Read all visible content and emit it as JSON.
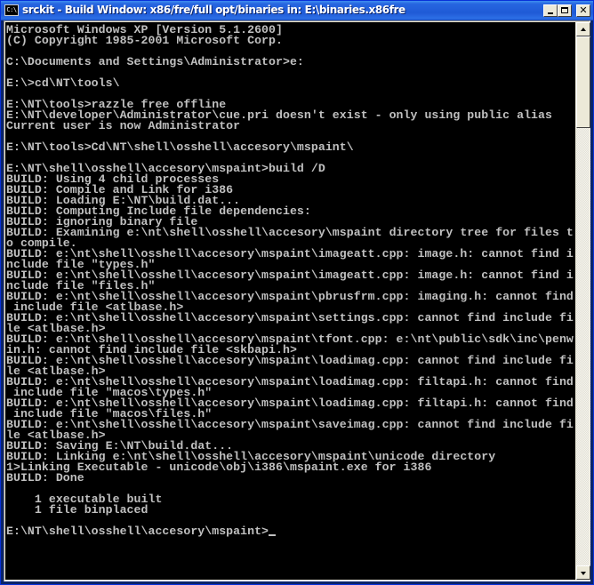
{
  "window": {
    "title": "srckit - Build Window: x86/fre/full opt/binaries in: E:\\binaries.x86fre",
    "icon": "console-icon",
    "icon_label": "C:\\",
    "buttons": {
      "minimize": "minimize",
      "maximize": "maximize",
      "close": "close"
    }
  },
  "console": {
    "colors": {
      "background": "#000000",
      "text": "#c0c0c0"
    },
    "lines": [
      "Microsoft Windows XP [Version 5.1.2600]",
      "(C) Copyright 1985-2001 Microsoft Corp.",
      "",
      "C:\\Documents and Settings\\Administrator>e:",
      "",
      "E:\\>cd\\NT\\tools\\",
      "",
      "E:\\NT\\tools>razzle free offline",
      "E:\\NT\\developer\\Administrator\\cue.pri doesn't exist - only using public alias",
      "Current user is now Administrator",
      "",
      "E:\\NT\\tools>Cd\\NT\\shell\\osshell\\accesory\\mspaint\\",
      "",
      "E:\\NT\\shell\\osshell\\accesory\\mspaint>build /D",
      "BUILD: Using 4 child processes",
      "BUILD: Compile and Link for i386",
      "BUILD: Loading E:\\NT\\build.dat...",
      "BUILD: Computing Include file dependencies:",
      "BUILD: ignoring binary file",
      "BUILD: Examining e:\\nt\\shell\\osshell\\accesory\\mspaint directory tree for files t",
      "o compile.",
      "BUILD: e:\\nt\\shell\\osshell\\accesory\\mspaint\\imageatt.cpp: image.h: cannot find i",
      "nclude file \"types.h\"",
      "BUILD: e:\\nt\\shell\\osshell\\accesory\\mspaint\\imageatt.cpp: image.h: cannot find i",
      "nclude file \"files.h\"",
      "BUILD: e:\\nt\\shell\\osshell\\accesory\\mspaint\\pbrusfrm.cpp: imaging.h: cannot find",
      " include file <atlbase.h>",
      "BUILD: e:\\nt\\shell\\osshell\\accesory\\mspaint\\settings.cpp: cannot find include fi",
      "le <atlbase.h>",
      "BUILD: e:\\nt\\shell\\osshell\\accesory\\mspaint\\tfont.cpp: e:\\nt\\public\\sdk\\inc\\penw",
      "in.h: cannot find include file <skbapi.h>",
      "BUILD: e:\\nt\\shell\\osshell\\accesory\\mspaint\\loadimag.cpp: cannot find include fi",
      "le <atlbase.h>",
      "BUILD: e:\\nt\\shell\\osshell\\accesory\\mspaint\\loadimag.cpp: filtapi.h: cannot find",
      " include file \"macos\\types.h\"",
      "BUILD: e:\\nt\\shell\\osshell\\accesory\\mspaint\\loadimag.cpp: filtapi.h: cannot find",
      " include file \"macos\\files.h\"",
      "BUILD: e:\\nt\\shell\\osshell\\accesory\\mspaint\\saveimag.cpp: cannot find include fi",
      "le <atlbase.h>",
      "BUILD: Saving E:\\NT\\build.dat...",
      "BUILD: Linking e:\\nt\\shell\\osshell\\accesory\\mspaint\\unicode directory",
      "1>Linking Executable - unicode\\obj\\i386\\mspaint.exe for i386",
      "BUILD: Done",
      "",
      "    1 executable built",
      "    1 file binplaced",
      "",
      "E:\\NT\\shell\\osshell\\accesory\\mspaint>"
    ]
  },
  "scrollbar": {
    "up_icon": "arrow-up-icon",
    "down_icon": "arrow-down-icon",
    "position_fraction": 0.0
  }
}
